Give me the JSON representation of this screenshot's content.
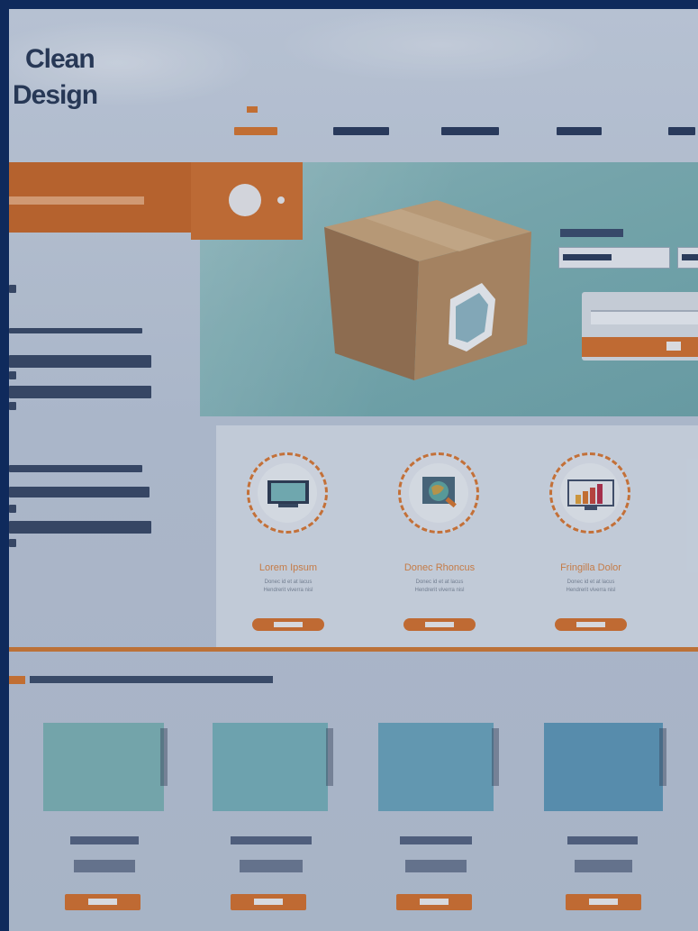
{
  "logo": {
    "line1": "Clean",
    "line2": "Design"
  },
  "nav": {
    "items": [
      {
        "label": "",
        "active": true
      },
      {
        "label": "",
        "active": false
      },
      {
        "label": "",
        "active": false
      },
      {
        "label": "",
        "active": false
      },
      {
        "label": "",
        "active": false
      }
    ]
  },
  "hero": {
    "title": ""
  },
  "features": [
    {
      "title": "Lorem Ipsum",
      "subtitle_line1": "Donec id et at lacus",
      "subtitle_line2": "Hendrerit viverra nisl",
      "icon": "monitor-icon"
    },
    {
      "title": "Donec Rhoncus",
      "subtitle_line1": "Donec id et at lacus",
      "subtitle_line2": "Hendrerit viverra nisl",
      "icon": "globe-magnifier-icon"
    },
    {
      "title": "Fringilla Dolor",
      "subtitle_line1": "Donec id et at lacus",
      "subtitle_line2": "Hendrerit viverra nisl",
      "icon": "bar-chart-display-icon"
    }
  ],
  "bottom": {
    "heading": "",
    "tiles": [
      {
        "color": "#7eb3b4"
      },
      {
        "color": "#78b0b8"
      },
      {
        "color": "#6ba4ba"
      },
      {
        "color": "#5f98b6"
      }
    ]
  },
  "colors": {
    "accent": "#d5762f",
    "frame": "#0f2a5c",
    "hero": "#7fb2b4"
  }
}
